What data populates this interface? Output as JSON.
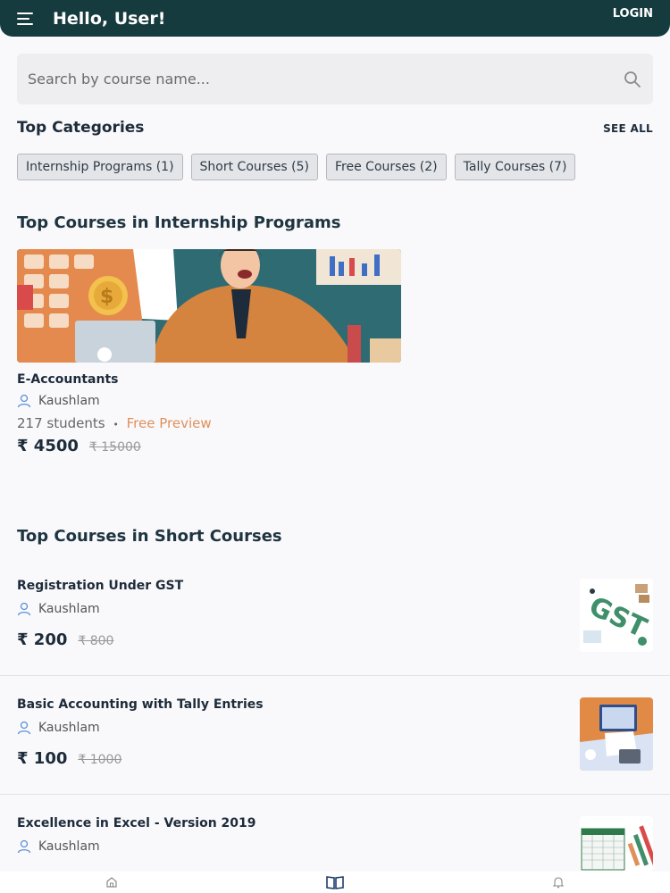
{
  "header": {
    "greeting": "Hello, User!",
    "login_label": "LOGIN"
  },
  "search": {
    "placeholder": "Search by course name..."
  },
  "categories": {
    "title": "Top Categories",
    "see_all": "SEE ALL",
    "chips": [
      "Internship Programs (1)",
      "Short Courses (5)",
      "Free Courses (2)",
      "Tally Courses (7)"
    ]
  },
  "internship": {
    "title": "Top Courses in Internship Programs",
    "course": {
      "title": "E-Accountants",
      "author": "Kaushlam",
      "students": "217 students",
      "separator": "•",
      "preview": "Free Preview",
      "price": "₹ 4500",
      "old_price": "₹ 15000"
    }
  },
  "short": {
    "title": "Top Courses in Short Courses",
    "courses": [
      {
        "title": "Registration Under GST",
        "author": "Kaushlam",
        "price": "₹ 200",
        "old_price": "₹ 800"
      },
      {
        "title": "Basic Accounting with Tally Entries",
        "author": "Kaushlam",
        "price": "₹ 100",
        "old_price": "₹ 1000"
      },
      {
        "title": "Excellence in Excel - Version 2019",
        "author": "Kaushlam"
      }
    ]
  },
  "colors": {
    "header_bg": "#163b3e",
    "accent_orange": "#e0905a",
    "icon_blue": "#5b8fd6"
  }
}
